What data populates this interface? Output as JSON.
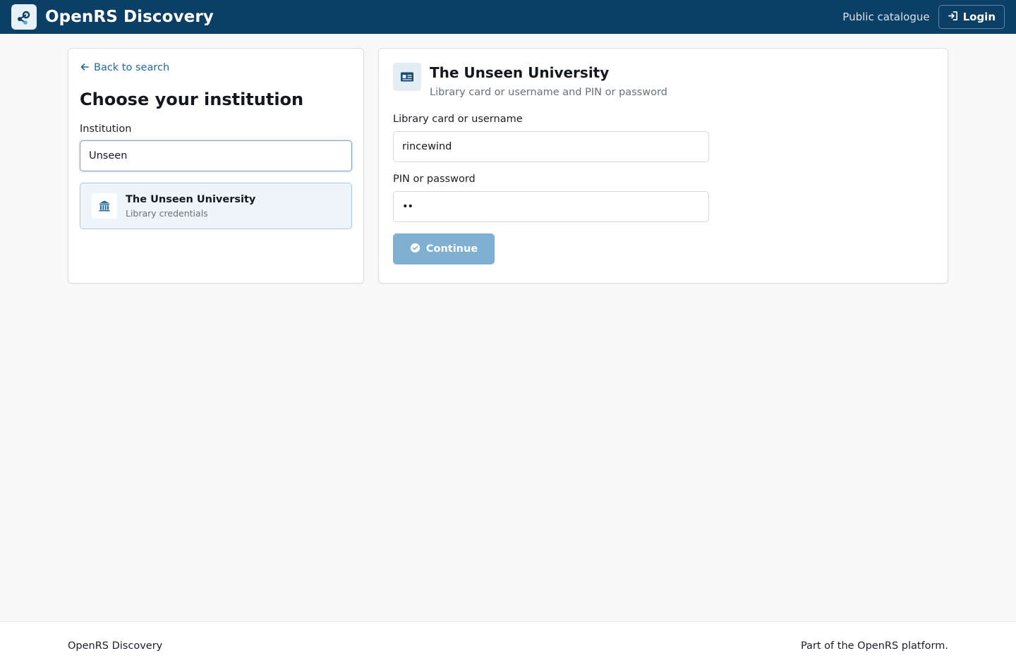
{
  "header": {
    "app_name": "OpenRS Discovery",
    "logo_icon": "share-nodes-icon",
    "public_catalogue": "Public catalogue",
    "login_label": "Login",
    "login_icon": "sign-in-icon",
    "bg_color": "#0c3f66"
  },
  "left_panel": {
    "back_label": "Back to search",
    "back_icon": "arrow-left-icon",
    "title": "Choose your institution",
    "institution_label": "Institution",
    "institution_value": "Unseen",
    "results": [
      {
        "name": "The Unseen University",
        "subtitle": "Library credentials",
        "icon": "building-columns-icon"
      }
    ]
  },
  "right_panel": {
    "icon": "id-card-icon",
    "title": "The Unseen University",
    "subtitle": "Library card or username and PIN or password",
    "username_label": "Library card or username",
    "username_value": "rincewind",
    "password_label": "PIN or password",
    "password_value": "••",
    "continue_label": "Continue",
    "continue_icon": "check-circle-icon",
    "accent_color": "#7fb0d1"
  },
  "footer": {
    "left": "OpenRS Discovery",
    "right": "Part of the OpenRS platform."
  }
}
